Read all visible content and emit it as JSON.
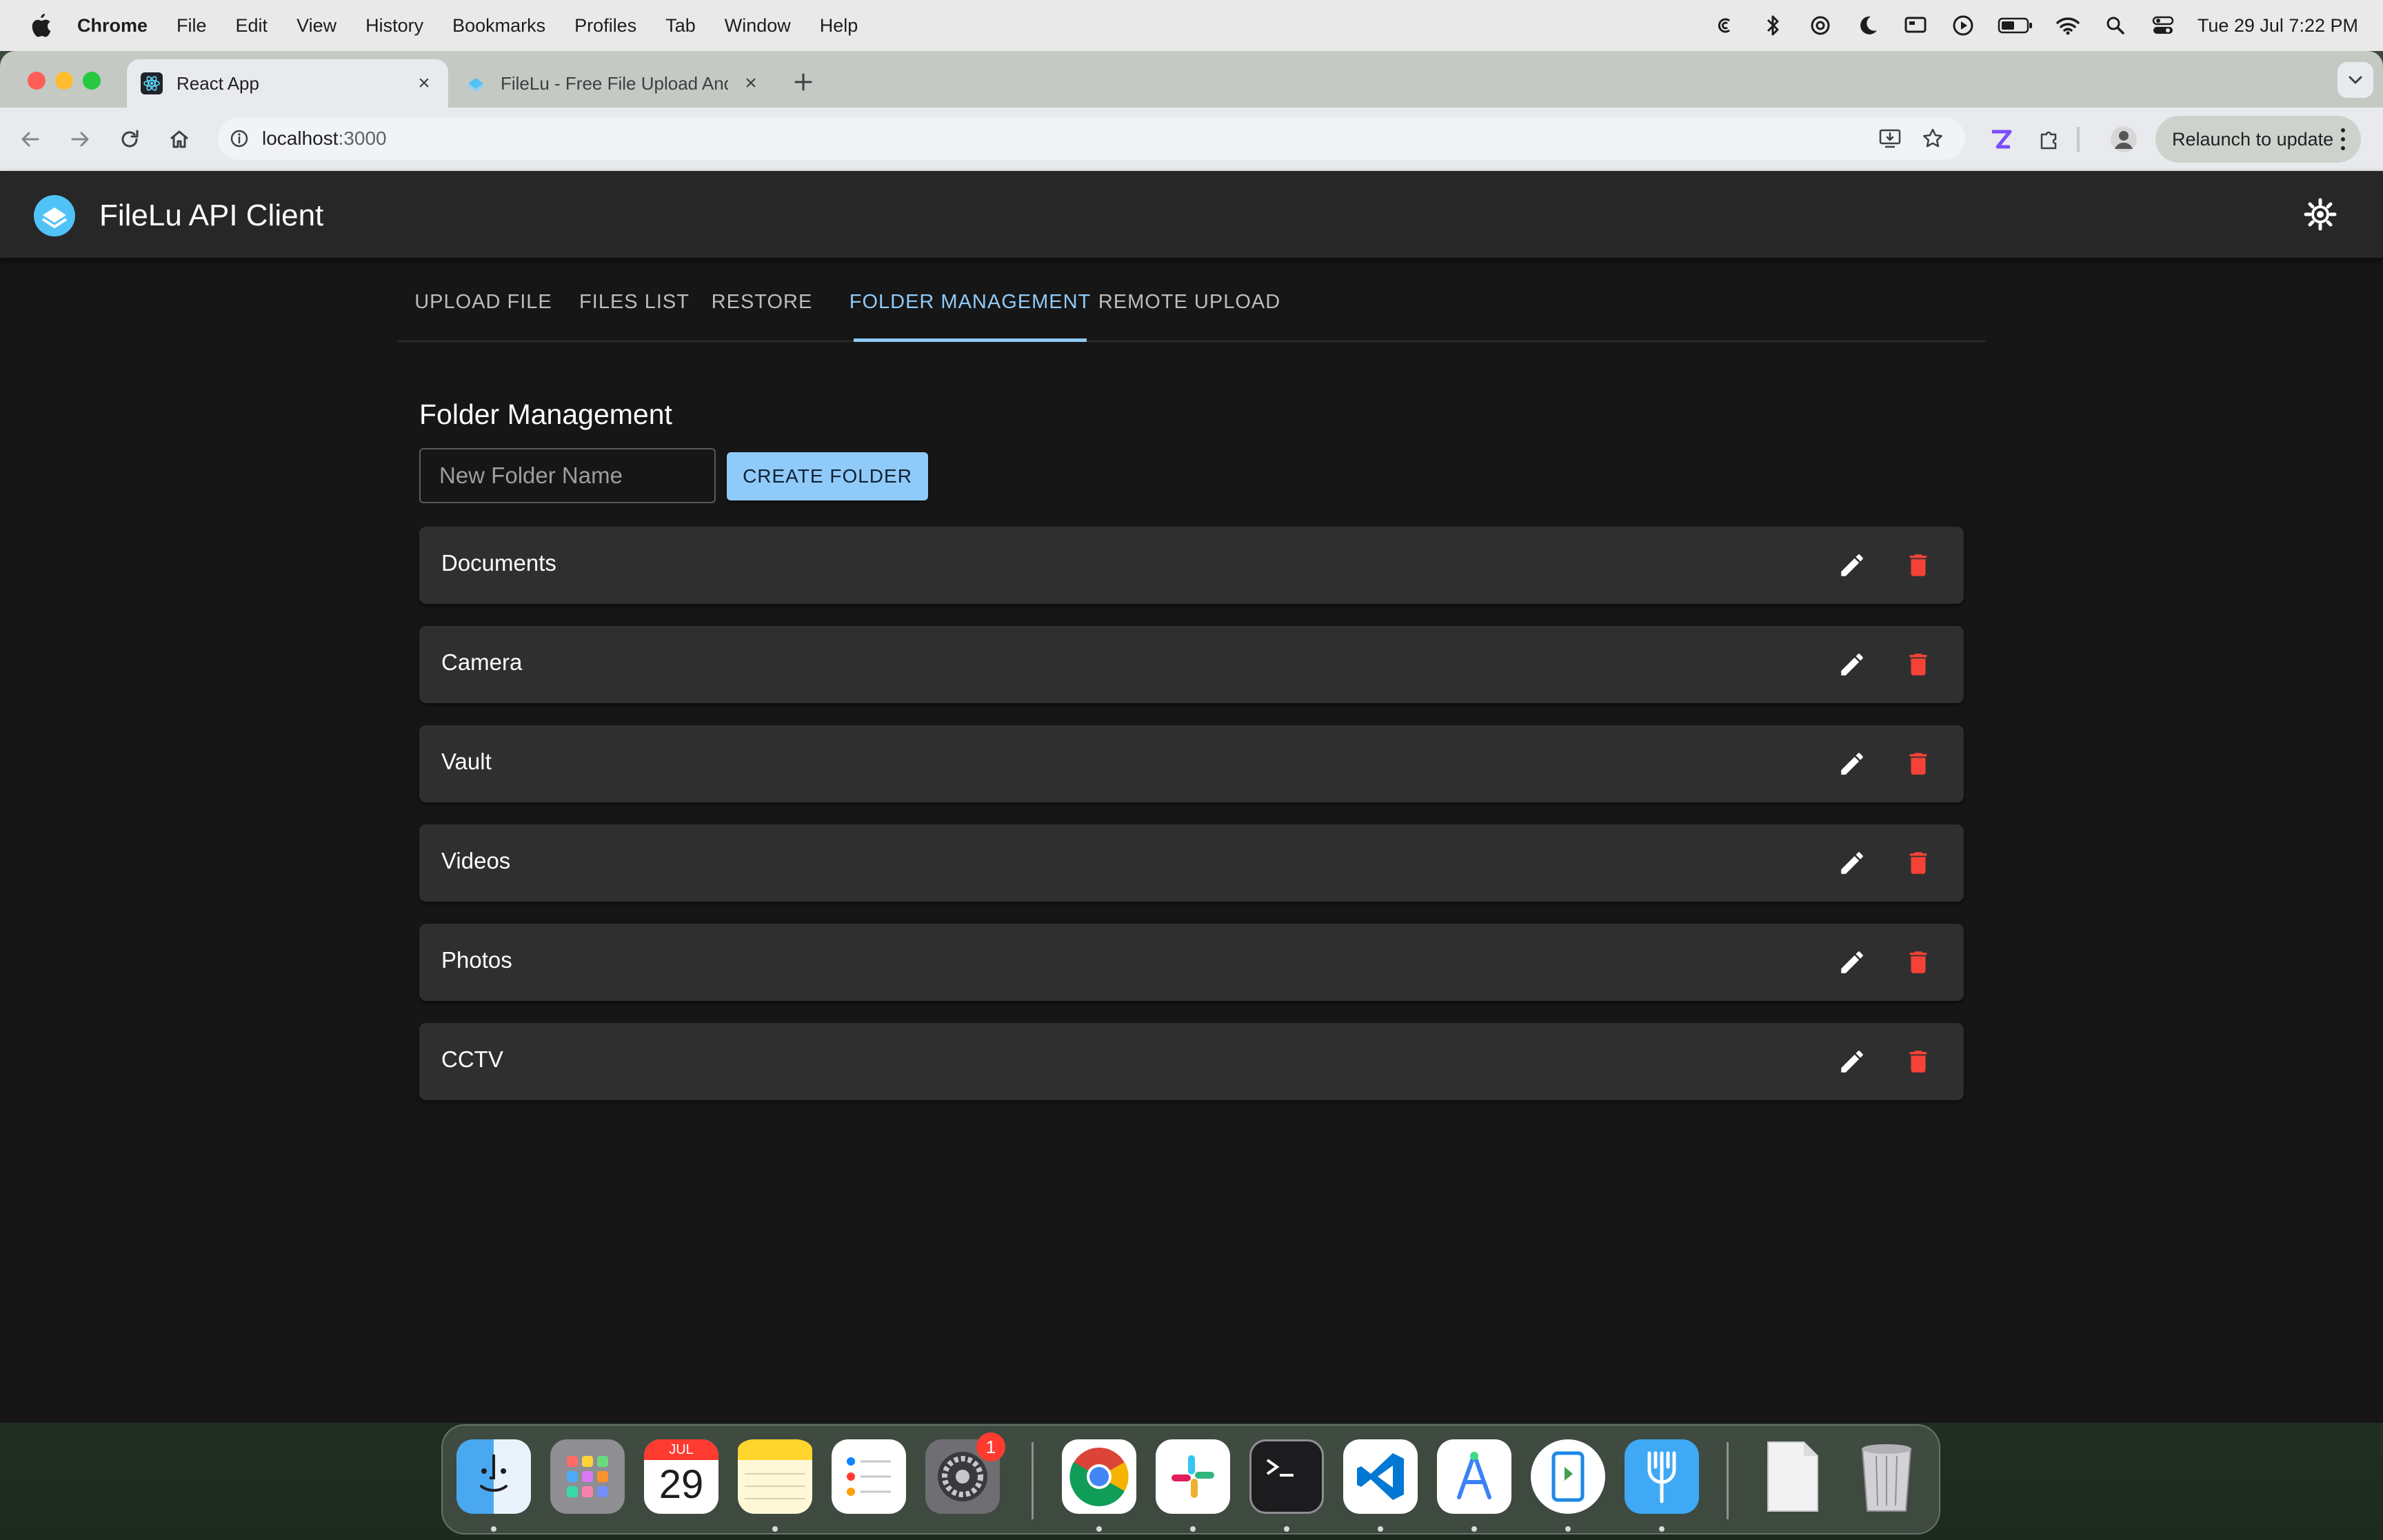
{
  "menubar": {
    "app_name": "Chrome",
    "items": [
      "File",
      "Edit",
      "View",
      "History",
      "Bookmarks",
      "Profiles",
      "Tab",
      "Window",
      "Help"
    ],
    "status_icons": [
      "creative-cloud-icon",
      "bluetooth-icon",
      "chatgpt-icon",
      "focus-moon-icon",
      "screen-mirroring-icon",
      "play-circle-icon",
      "battery-icon",
      "wifi-icon",
      "spotlight-search-icon",
      "control-center-icon"
    ],
    "clock": "Tue 29 Jul  7:22 PM"
  },
  "browser": {
    "tabs": [
      {
        "title": "React App",
        "icon": "react-icon",
        "active": true
      },
      {
        "title": "FileLu - Free File Upload And",
        "icon": "filelu-icon",
        "active": false
      }
    ],
    "url_host": "localhost",
    "url_port": ":3000",
    "relaunch_label": "Relaunch to update"
  },
  "app": {
    "title": "FileLu API Client",
    "tabs": [
      "UPLOAD FILE",
      "FILES LIST",
      "RESTORE",
      "FOLDER MANAGEMENT",
      "REMOTE UPLOAD"
    ],
    "selected_tab": "FOLDER MANAGEMENT",
    "accent_color": "#90caf9",
    "delete_color": "#f44336"
  },
  "folder_management": {
    "heading": "Folder Management",
    "input_placeholder": "New Folder Name",
    "input_value": "",
    "create_label": "CREATE FOLDER",
    "folders": [
      "Documents",
      "Camera",
      "Vault",
      "Videos",
      "Photos",
      "CCTV"
    ]
  },
  "dock": {
    "apps": [
      "finder-icon",
      "launchpad-icon",
      "calendar-icon",
      "notes-icon",
      "reminders-icon",
      "system-settings-icon",
      "chrome-icon",
      "slack-icon",
      "terminal-icon",
      "vscode-icon",
      "android-studio-icon",
      "simulator-icon",
      "fork-icon",
      "document-icon",
      "trash-icon"
    ],
    "calendar_month": "JUL",
    "calendar_day": "29",
    "settings_badge": "1"
  }
}
